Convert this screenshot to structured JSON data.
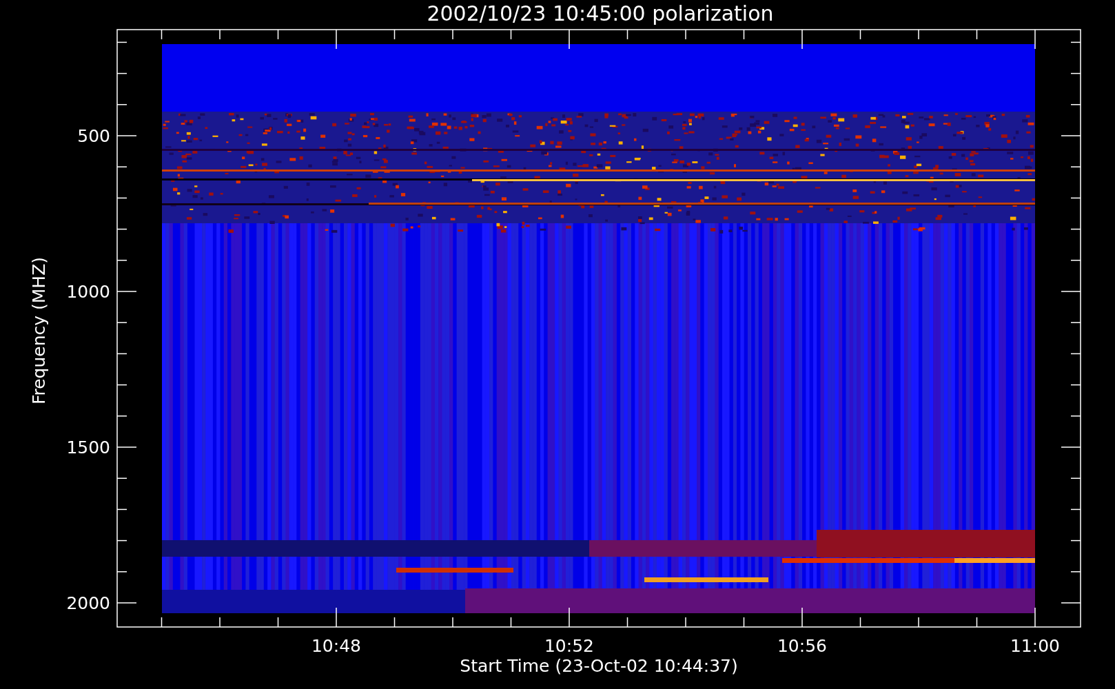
{
  "title": "2002/10/23 10:45:00 polarization",
  "y_axis": {
    "label": "Frequency (MHZ)",
    "ticks": [
      "500",
      "1000",
      "1500",
      "2000"
    ]
  },
  "x_axis": {
    "label": "Start Time (23-Oct-02 10:44:37)",
    "ticks": [
      "10:48",
      "10:52",
      "10:56",
      "11:00"
    ]
  }
}
